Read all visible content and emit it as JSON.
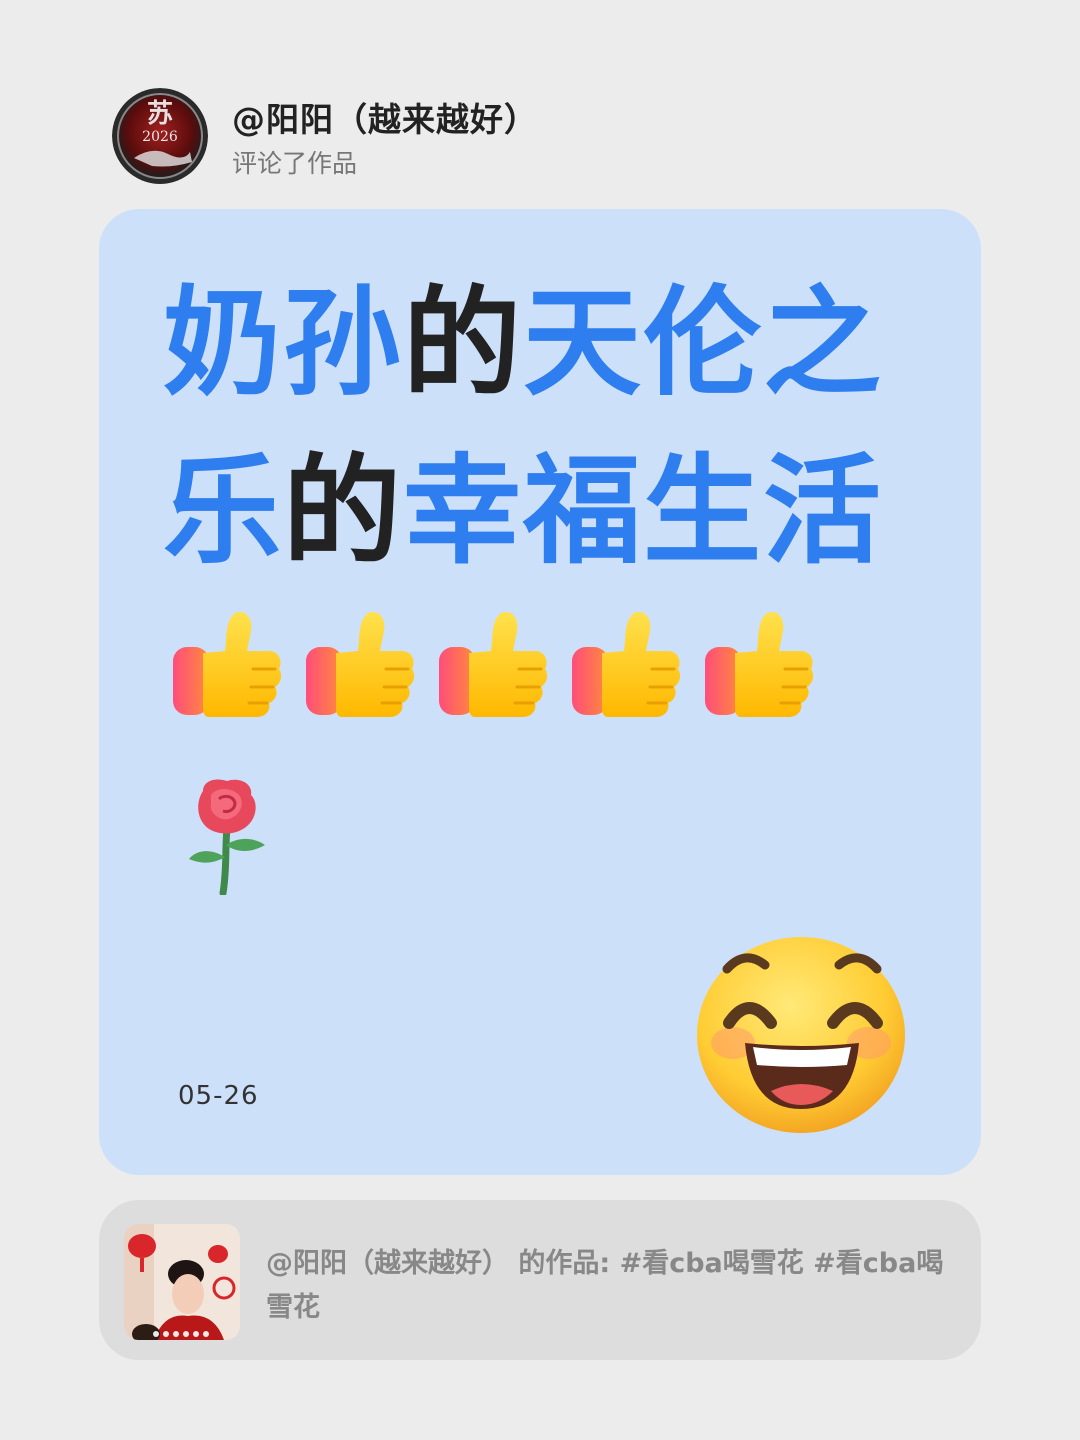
{
  "user": {
    "name": "@阳阳（越来越好）",
    "action": "评论了作品",
    "avatar_text": "苏",
    "avatar_year": "2026"
  },
  "comment": {
    "headline_segments": [
      {
        "text": "奶孙",
        "color": "blue"
      },
      {
        "text": "的",
        "color": "dark"
      },
      {
        "text": "天伦之乐",
        "color": "blue"
      },
      {
        "text": "的",
        "color": "dark"
      },
      {
        "text": "幸福生活",
        "color": "blue"
      }
    ],
    "thumbs_up_icons": [
      "thumbs-up-icon",
      "thumbs-up-icon",
      "thumbs-up-icon",
      "thumbs-up-icon",
      "thumbs-up-icon"
    ],
    "rose_icon": "rose-icon",
    "sticker_icon": "grinning-face-icon",
    "date": "05-26"
  },
  "work": {
    "text": "@阳阳（越来越好） 的作品: #看cba喝雪花 #看cba喝雪花"
  },
  "colors": {
    "page_bg": "#ececec",
    "card_bg": "#cde0fa",
    "accent_blue": "#2e7ef0",
    "dark_text": "#222222",
    "work_bg": "#dddddd"
  }
}
